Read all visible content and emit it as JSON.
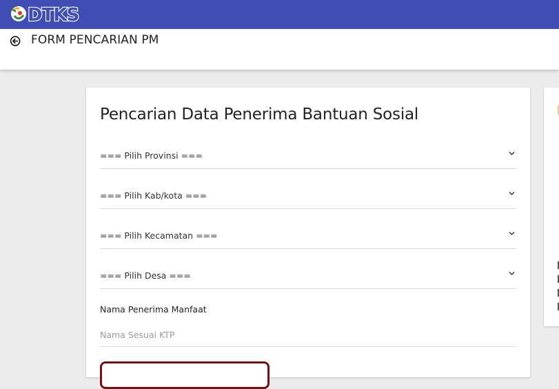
{
  "header": {
    "logo_text": "DTKS",
    "brand_color": "#3f4db5"
  },
  "subheader": {
    "back_icon": "arrow-left-circle-icon",
    "title": "FORM PENCARIAN PM"
  },
  "form": {
    "heading": "Pencarian Data Penerima Bantuan Sosial",
    "selects": [
      {
        "label": "=== Pilih Provinsi ==="
      },
      {
        "label": "=== Pilih Kab/kota ==="
      },
      {
        "label": "=== Pilih Kecamatan ==="
      },
      {
        "label": "=== Pilih Desa ==="
      }
    ],
    "name_label": "Nama Penerima Manfaat",
    "name_placeholder": "Nama Sesuai KTP",
    "name_value": "",
    "button_border_color": "#7b0f10"
  }
}
